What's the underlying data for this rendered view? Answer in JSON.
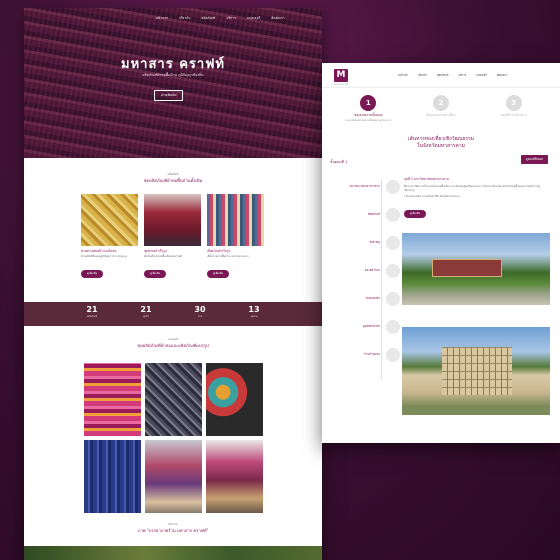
{
  "left_page": {
    "nav": [
      "หน้าแรก",
      "เกี่ยวกับ",
      "ผลิตภัณฑ์",
      "บริการ",
      "แกลเลอรี่",
      "ติดต่อเรา"
    ],
    "hero": {
      "title": "มหาสาร คราฟท์",
      "subtitle": "ผลิตภัณฑ์ผ้าทอพื้นบ้าน ภูมิปัญญาท้องถิ่น",
      "button": "อ่านเพิ่มเติม"
    },
    "section1": {
      "small": "ผลิตภัณฑ์",
      "title": "ชุดผลิตภัณฑ์ผ้าทอพื้นบ้านดั้งเดิม"
    },
    "cards": [
      {
        "title": "ผ้าทอลายมัดหมี่ แบบดั้งเดิม",
        "text": "ผ้าทอมือที่สืบทอดภูมิปัญญาจากบรรพบุรุษ",
        "button": "ดูเพิ่มเติม"
      },
      {
        "title": "ชุดผ้าทอสำเร็จรูป",
        "text": "ตัดเย็บด้วยผ้าทอพื้นเมืองคุณภาพดี",
        "button": "ดูเพิ่มเติม"
      },
      {
        "title": "เสื้อผ้าทอสำเร็จรูป",
        "text": "เสื้อผ้าทอลายพื้นบ้าน หลากหลายแบบ",
        "button": "ดูเพิ่มเติม"
      }
    ],
    "stats": [
      {
        "num": "21",
        "label": "ผลิตภัณฑ์"
      },
      {
        "num": "21",
        "label": "ลูกค้า"
      },
      {
        "num": "30",
        "label": "ลาย"
      },
      {
        "num": "13",
        "label": "ชุมชน"
      }
    ],
    "section2": {
      "small": "แกลเลอรี่",
      "title": "ชุดผลิตภัณฑ์ผ้าทอและผลิตภัณฑ์แปรรูป"
    },
    "section3": {
      "small": "กิจกรรม",
      "title": "ภาพ \"บรรยากาศร้าน มหาสาร คราฟท์\""
    }
  },
  "right_page": {
    "logo": "M",
    "logo_sub": "มหาสาร คราฟท์",
    "nav": [
      "หน้าแรก",
      "เกี่ยวกับ",
      "ผลิตภัณฑ์",
      "บริการ",
      "แกลเลอรี่",
      "ติดต่อเรา"
    ],
    "steps": [
      {
        "n": "1",
        "title": "ขอบเขตงานทั้งหมด",
        "text": "รายละเอียดขอบเขตงานทั้งหมด ของโครงการ",
        "color": "#7a1856"
      },
      {
        "n": "2",
        "title": "ข้อมูลแหล่งท่องเที่ยว",
        "text": "",
        "color": "#dcdcdc"
      },
      {
        "n": "3",
        "title": "แผนที่การเดินทาง",
        "text": "",
        "color": "#dcdcdc"
      }
    ],
    "title_line1": "เส้นทางท่องเที่ยวเชิงวัฒนธรรม",
    "title_line2": "ในจังหวัดมหาสารคาม",
    "button": "ดูแผนที่ทั้งหมด",
    "list_header": "ขั้นตอนที่ 1",
    "timeline": [
      "มหาวิทยาลัยมหาสารคาม",
      "พิพิธภัณฑ์",
      "วัดสำคัญ",
      "ตลาดผ้าไหม",
      "ชุมชนทอผ้า",
      "ศูนย์หัตถกรรม",
      "ร้านค้าชุมชน"
    ],
    "detail": {
      "heading": "จุดที่ 1 มหาวิทยาลัยมหาสารคาม",
      "text": "ศึกษาประวัติความเป็นมาของผ้าทอพื้นเมือง และเยี่ยมชมศูนย์วัฒนธรรม ภายในมหาวิทยาลัย พร้อมเรียนรู้ขั้นตอนการทอผ้าจากผู้เชี่ยวชาญ",
      "location": "ตำบลขามเรียง อำเภอกันทรวิชัย จังหวัดมหาสารคาม",
      "button": "ดูเพิ่มเติม"
    }
  },
  "colors": {
    "accent": "#7a1856",
    "stats_bar": "#5a2a3a",
    "background": "#3a0f32"
  }
}
